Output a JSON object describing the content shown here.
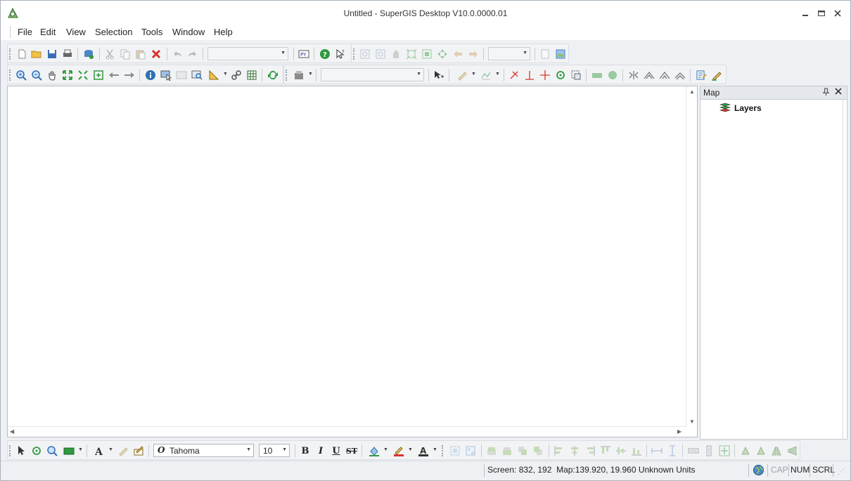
{
  "window": {
    "title": "Untitled - SuperGIS Desktop V10.0.0000.01",
    "app_icon": "supergis-app-icon",
    "controls": {
      "minimize": "minimize-icon",
      "restore": "restore-icon",
      "close": "close-icon"
    }
  },
  "menu": {
    "items": [
      "File",
      "Edit",
      "View",
      "Selection",
      "Tools",
      "Window",
      "Help"
    ]
  },
  "toolbars": {
    "standard": {
      "buttons": [
        "new-document-icon",
        "open-folder-icon",
        "save-icon",
        "print-icon",
        "add-data-icon",
        "cut-icon",
        "copy-icon",
        "paste-icon",
        "delete-icon",
        "undo-icon",
        "redo-icon",
        "python-icon",
        "help-icon",
        "whats-this-icon"
      ],
      "scale_value": ""
    },
    "navigation2": {
      "buttons": [
        "fixed-zoom-in-icon",
        "fixed-zoom-out-icon",
        "pan-icon",
        "full-extent-icon",
        "zoom-to-layer-icon",
        "center-map-icon",
        "back-extent-icon",
        "forward-extent-icon",
        "layout-icon",
        "map-view-icon"
      ],
      "combo_value": ""
    },
    "tools": {
      "buttons": [
        "zoom-in-icon",
        "zoom-out-icon",
        "hand-pan-icon",
        "expand-extent-icon",
        "fixed-expand-icon",
        "zoom-to-selected-icon",
        "previous-extent-icon",
        "next-extent-icon",
        "identify-icon",
        "select-features-icon",
        "html-popup-icon",
        "find-icon",
        "measure-icon",
        "hyperlink-icon",
        "attribute-table-icon",
        "refresh-icon"
      ]
    },
    "editing": {
      "buttons": [
        "editor-menu-icon",
        "edit-tool-icon",
        "sketch-tool-icon",
        "sketch-dropdown-icon",
        "edit-vertex-icon",
        "perpendicular-icon",
        "cross-icon",
        "rotate-icon",
        "extent-select-icon",
        "rectangle-icon",
        "circle-icon",
        "split-icon",
        "mirror-icon",
        "reshape-icon",
        "trim-icon",
        "attributes-icon",
        "edit-pencil-icon"
      ],
      "target_value": ""
    },
    "drawing": {
      "buttons": [
        "select-elements-icon",
        "rotate-element-icon",
        "zoom-element-icon",
        "rectangle-draw-icon",
        "text-icon",
        "highlight-icon",
        "callout-icon"
      ],
      "font_name": "Tahoma",
      "font_size": "10",
      "format_buttons": {
        "bold": "B",
        "italic": "I",
        "underline": "U",
        "strikethrough": "ST"
      },
      "color_buttons": [
        "fill-color-icon",
        "line-color-icon",
        "font-color-icon"
      ],
      "arrange_buttons": [
        "group-icon",
        "ungroup-icon",
        "bring-to-front-icon",
        "send-to-back-icon",
        "bring-forward-icon",
        "send-backward-icon",
        "align-left-icon",
        "align-center-icon",
        "align-right-icon",
        "align-top-icon",
        "align-middle-icon",
        "align-bottom-icon",
        "distribute-horizontally-icon",
        "distribute-vertically-icon",
        "make-same-width-icon",
        "make-same-height-icon",
        "make-same-size-icon",
        "rotate-left-icon",
        "rotate-right-icon",
        "flip-horizontal-icon",
        "flip-vertical-icon"
      ]
    }
  },
  "toc": {
    "title": "Map",
    "pin": "pin-icon",
    "close": "close-icon",
    "root": {
      "icon": "layers-icon",
      "label": "Layers"
    }
  },
  "status": {
    "coords": "Screen: 832, 192  Map:139.920, 19.960 Unknown Units",
    "keys": {
      "cap": "CAP",
      "num": "NUM",
      "scrl": "SCRL"
    }
  },
  "colors": {
    "accent_red": "#d9342b",
    "accent_green": "#2f9a3e",
    "accent_blue": "#2f6fb5"
  }
}
